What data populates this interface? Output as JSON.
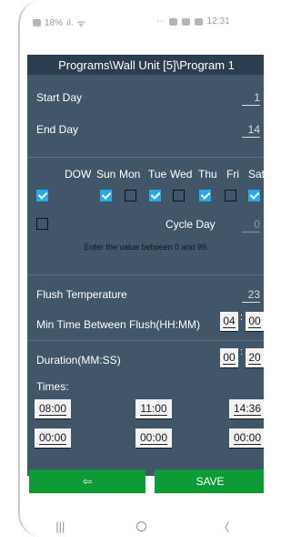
{
  "status_bar": {
    "battery": "18%",
    "dots": "··",
    "time": "12:31"
  },
  "title": "Programs\\Wall Unit [5]\\Program 1",
  "start_day": {
    "label": "Start Day",
    "value": "1"
  },
  "end_day": {
    "label": "End Day",
    "value": "14"
  },
  "dow": {
    "header_label": "DOW",
    "days": [
      "Sun",
      "Mon",
      "Tue",
      "Wed",
      "Thu",
      "Fri",
      "Sat"
    ],
    "dow_checked": true,
    "checked": [
      true,
      false,
      true,
      false,
      true,
      false,
      true
    ]
  },
  "cycle_day": {
    "label": "Cycle Day",
    "value": "0",
    "checked": false
  },
  "hint": "Enter the value between 0 and 99.",
  "flush_temperature": {
    "label": "Flush Temperature",
    "value": "23"
  },
  "min_time": {
    "label": "Min Time Between Flush(HH:MM)",
    "hours": "04",
    "minutes": "00"
  },
  "duration": {
    "label": "Duration(MM:SS)",
    "minutes": "00",
    "seconds": "20"
  },
  "times": {
    "label": "Times:",
    "values": [
      "08:00",
      "11:00",
      "14:36",
      "00:00",
      "00:00",
      "00:00"
    ]
  },
  "buttons": {
    "back": "⇦",
    "save": "SAVE"
  },
  "nav": {
    "recents": "|||",
    "back": "〈"
  },
  "colors": {
    "panel": "#42566a",
    "title_bar": "#2c3d4f",
    "accent": "#2aa9e6",
    "button": "#0d9b37"
  }
}
